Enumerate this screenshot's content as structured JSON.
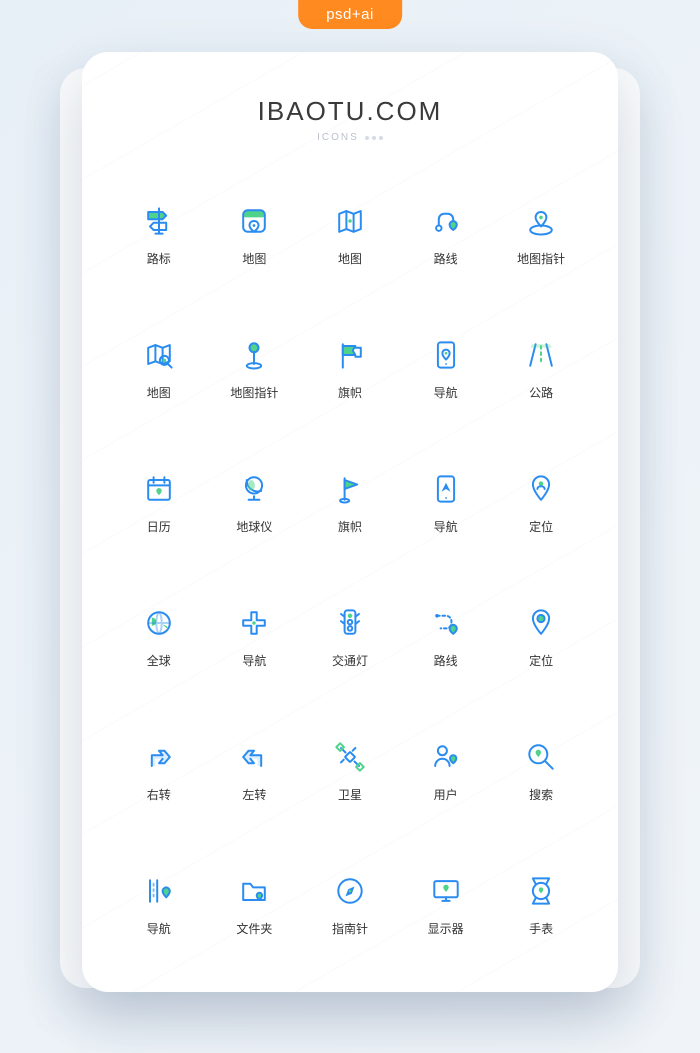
{
  "badge": "psd+ai",
  "header": {
    "title": "IBAOTU.COM",
    "subtitle": "ICONS"
  },
  "icons": [
    {
      "name": "signpost-icon",
      "label": "路标"
    },
    {
      "name": "map-app-icon",
      "label": "地图"
    },
    {
      "name": "map-fold-icon",
      "label": "地图"
    },
    {
      "name": "route-icon",
      "label": "路线"
    },
    {
      "name": "map-pointer-icon",
      "label": "地图指针"
    },
    {
      "name": "map-search-icon",
      "label": "地图"
    },
    {
      "name": "map-pin-pointer-icon",
      "label": "地图指针"
    },
    {
      "name": "flag-icon",
      "label": "旗帜"
    },
    {
      "name": "nav-phone-icon",
      "label": "导航"
    },
    {
      "name": "highway-icon",
      "label": "公路"
    },
    {
      "name": "calendar-icon",
      "label": "日历"
    },
    {
      "name": "globe-stand-icon",
      "label": "地球仪"
    },
    {
      "name": "flag-pennant-icon",
      "label": "旗帜"
    },
    {
      "name": "nav-compass-phone-icon",
      "label": "导航"
    },
    {
      "name": "location-user-icon",
      "label": "定位"
    },
    {
      "name": "earth-icon",
      "label": "全球"
    },
    {
      "name": "intersection-icon",
      "label": "导航"
    },
    {
      "name": "traffic-light-icon",
      "label": "交通灯"
    },
    {
      "name": "route-curve-icon",
      "label": "路线"
    },
    {
      "name": "location-pin-icon",
      "label": "定位"
    },
    {
      "name": "turn-right-icon",
      "label": "右转"
    },
    {
      "name": "turn-left-icon",
      "label": "左转"
    },
    {
      "name": "satellite-icon",
      "label": "卫星"
    },
    {
      "name": "user-location-icon",
      "label": "用户"
    },
    {
      "name": "search-icon",
      "label": "搜索"
    },
    {
      "name": "road-nav-icon",
      "label": "导航"
    },
    {
      "name": "folder-icon",
      "label": "文件夹"
    },
    {
      "name": "compass-icon",
      "label": "指南针"
    },
    {
      "name": "monitor-icon",
      "label": "显示器"
    },
    {
      "name": "watch-icon",
      "label": "手表"
    }
  ]
}
